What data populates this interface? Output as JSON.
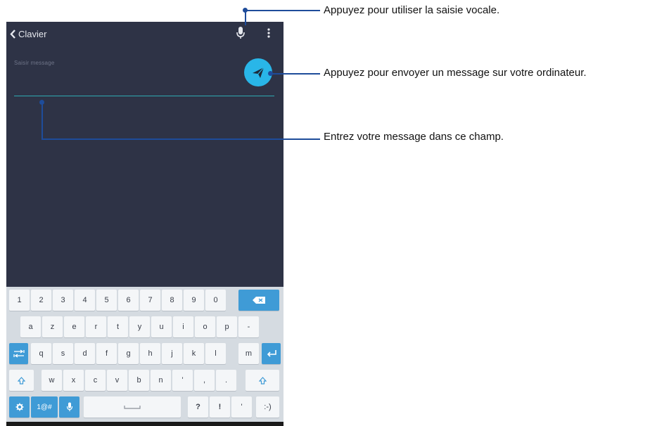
{
  "header": {
    "back_label": "Clavier"
  },
  "message": {
    "placeholder": "Saisir message"
  },
  "keyboard": {
    "row1": [
      "1",
      "2",
      "3",
      "4",
      "5",
      "6",
      "7",
      "8",
      "9",
      "0"
    ],
    "row2": [
      "a",
      "z",
      "e",
      "r",
      "t",
      "y",
      "u",
      "i",
      "o",
      "p",
      "-"
    ],
    "row3": [
      "q",
      "s",
      "d",
      "f",
      "g",
      "h",
      "j",
      "k",
      "l",
      "m"
    ],
    "row4": [
      "w",
      "x",
      "c",
      "v",
      "b",
      "n",
      "'",
      ",",
      "."
    ],
    "symbols_label": "1@#",
    "row5_right": [
      "?",
      "!",
      "'",
      ":-)"
    ]
  },
  "callouts": {
    "voice": "Appuyez pour utiliser la saisie vocale.",
    "send": "Appuyez pour envoyer un message sur votre ordinateur.",
    "field": "Entrez votre message dans ce champ."
  },
  "colors": {
    "screen_bg": "#2e3346",
    "accent_blue": "#29b6e8",
    "callout_line": "#1e4c9a",
    "keyboard_bg": "#d5dbe1"
  },
  "icons": [
    "chevron-left-icon",
    "microphone-icon",
    "overflow-menu-icon",
    "send-icon",
    "backspace-icon",
    "tab-icon",
    "shift-icon",
    "enter-icon",
    "gear-icon",
    "space-icon"
  ]
}
